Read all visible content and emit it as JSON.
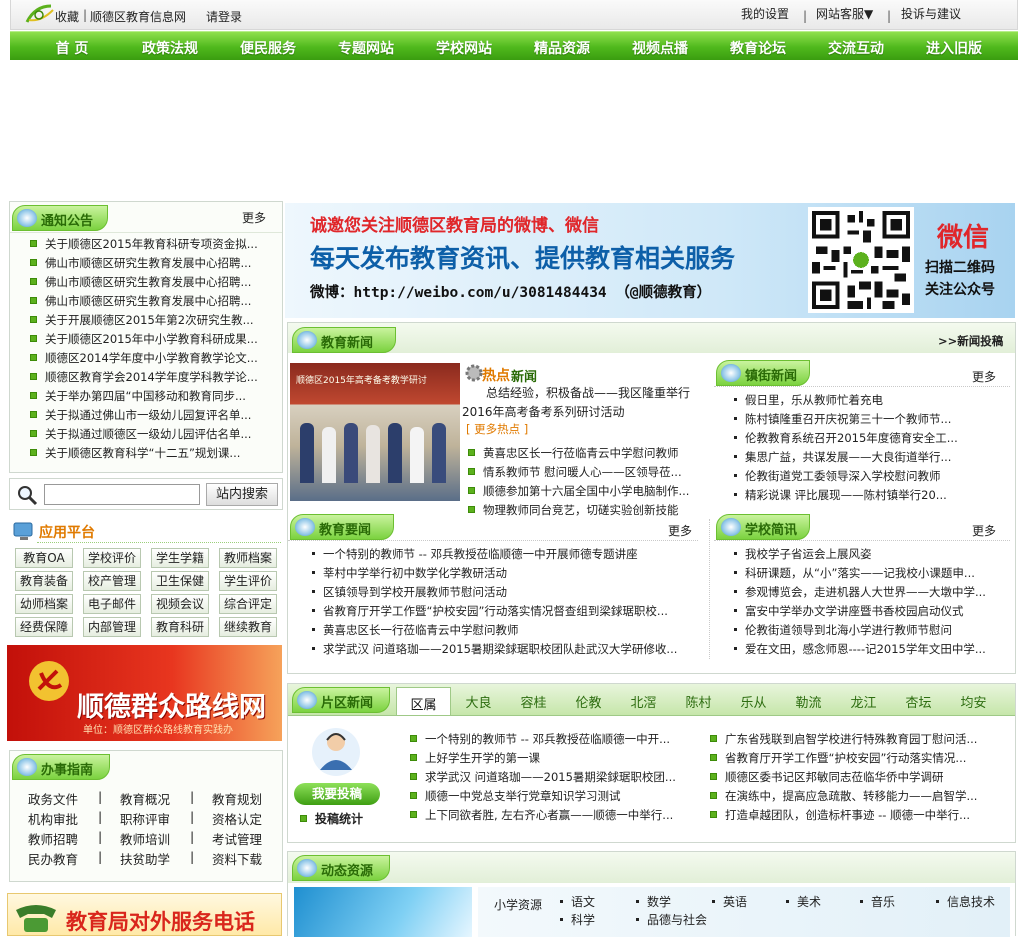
{
  "header": {
    "favorite": "收藏",
    "site_name": "顺德区教育信息网",
    "login": "请登录",
    "my_settings": "我的设置",
    "service": "网站客服▼",
    "complaint": "投诉与建议"
  },
  "nav": [
    "首 页",
    "政策法规",
    "便民服务",
    "专题网站",
    "学校网站",
    "精品资源",
    "视频点播",
    "教育论坛",
    "交流互动",
    "进入旧版"
  ],
  "notice": {
    "title": "通知公告",
    "more": "更多",
    "items": [
      "关于顺德区2015年教育科研专项资金拟...",
      "佛山市顺德区研究生教育发展中心招聘...",
      "佛山市顺德区研究生教育发展中心招聘...",
      "佛山市顺德区研究生教育发展中心招聘...",
      "关于开展顺德区2015年第2次研究生教...",
      "关于顺德区2015年中小学教育科研成果...",
      "顺德区2014学年度中小学教育教学论文...",
      "顺德区教育学会2014学年度学科教学论...",
      "关于举办第四届“中国移动和教育同步...",
      "关于拟通过佛山市一级幼儿园复评名单...",
      "关于拟通过顺德区一级幼儿园评估名单...",
      "关于顺德区教育科学“十二五”规划课..."
    ]
  },
  "search": {
    "placeholder": "",
    "button": "站内搜索"
  },
  "apps": {
    "title": "应用平台",
    "items": [
      "教育OA",
      "学校评价",
      "学生学籍",
      "教师档案",
      "教育装备",
      "校产管理",
      "卫生保健",
      "学生评价",
      "幼师档案",
      "电子邮件",
      "视频会议",
      "综合评定",
      "经费保障",
      "内部管理",
      "教育科研",
      "继续教育"
    ]
  },
  "banner_left": {
    "title": "顺德群众路线网",
    "subtitle": "单位：顺德区群众路线教育实践办"
  },
  "guide": {
    "title": "办事指南",
    "items": [
      "政务文件",
      "教育概况",
      "教育规划",
      "机构审批",
      "职称评审",
      "资格认定",
      "教师招聘",
      "教师培训",
      "考试管理",
      "民办教育",
      "扶贫助学",
      "资料下载"
    ]
  },
  "banner_phone": {
    "title": "教育局对外服务电话"
  },
  "weibo_banner": {
    "line1": "诚邀您关注顺德区教育局的微博、微信",
    "line2": "每天发布教育资讯、提供教育相关服务",
    "line3": "微博：http://weibo.com/u/3081484434 （@顺德教育）",
    "wechat": "微信",
    "scan": "扫描二维码",
    "follow": "关注公众号"
  },
  "edu_news": {
    "title": "教育新闻",
    "submit": ">>新闻投稿",
    "photo_caption": "顺德区2015年高考备考教学研讨",
    "hot_label": "热点",
    "hot_label2": "新闻",
    "hot_summary": "总结经验，积极备战——我区隆重举行2016年高考备考系列研讨活动",
    "hot_more": "[ 更多热点 ]",
    "hot_items": [
      "黄喜忠区长一行莅临青云中学慰问教师",
      "情系教师节 慰问暖人心——区领导莅...",
      "顺德参加第十六届全国中小学电脑制作...",
      "物理教师同台竞艺，切磋实验创新技能"
    ]
  },
  "town_news": {
    "title": "镇街新闻",
    "more": "更多",
    "items": [
      "假日里，乐从教师忙着充电",
      "陈村镇隆重召开庆祝第三十一个教师节...",
      "伦教教育系统召开2015年度德育安全工...",
      "集思广益，共谋发展——大良街道举行...",
      "伦教街道党工委领导深入学校慰问教师",
      "精彩说课 评比展现——陈村镇举行20..."
    ]
  },
  "edu_brief": {
    "title": "教育要闻",
    "more": "更多",
    "items": [
      "一个特别的教师节 -- 邓兵教授莅临顺德一中开展师德专题讲座",
      "莘村中学举行初中数学化学教研活动",
      "区镇领导到学校开展教师节慰问活动",
      "省教育厅开学工作暨“护校安园”行动落实情况督查组到梁銶琚职校...",
      "黄喜忠区长一行莅临青云中学慰问教师",
      "求学武汉 问道珞珈——2015暑期梁銶琚职校团队赴武汉大学研修收..."
    ]
  },
  "school_brief": {
    "title": "学校简讯",
    "more": "更多",
    "items": [
      "我校学子省运会上展风姿",
      "科研课题，从“小”落实——记我校小课题申...",
      "参观博览会，走进机器人大世界——大墩中学...",
      "富安中学举办文学讲座暨书香校园启动仪式",
      "伦教街道领导到北海小学进行教师节慰问",
      "爱在文田，感念师恩----记2015学年文田中学..."
    ]
  },
  "district_news": {
    "title": "片区新闻",
    "tabs": [
      "区属",
      "大良",
      "容桂",
      "伦教",
      "北滘",
      "陈村",
      "乐从",
      "勒流",
      "龙江",
      "杏坛",
      "均安"
    ],
    "active_tab": "区属",
    "submit": "我要投稿",
    "stats": "投稿统计",
    "left_items": [
      "一个特别的教师节 -- 邓兵教授莅临顺德一中开...",
      "上好学生开学的第一课",
      "求学武汉 问道珞珈——2015暑期梁銶琚职校团...",
      "顺德一中党总支举行党章知识学习测试",
      "上下同欲者胜, 左右齐心者赢——顺德一中举行..."
    ],
    "right_items": [
      "广东省残联到启智学校进行特殊教育园丁慰问活...",
      "省教育厅开学工作暨“护校安园”行动落实情况...",
      "顺德区委书记区邦敏同志莅临华侨中学调研",
      "在演练中，提高应急疏散、转移能力——启智学...",
      "打造卓越团队，创造标杆事迹 -- 顺德一中举行..."
    ]
  },
  "resources": {
    "title": "动态资源",
    "level": "小学资源",
    "subjects": [
      "语文",
      "数学",
      "英语",
      "美术",
      "音乐",
      "信息技术",
      "科学",
      "品德与社会"
    ]
  },
  "colors": {
    "nav_green": "#4fb81c",
    "banner_red": "#d9261c",
    "title_blue": "#0d5fa8"
  }
}
